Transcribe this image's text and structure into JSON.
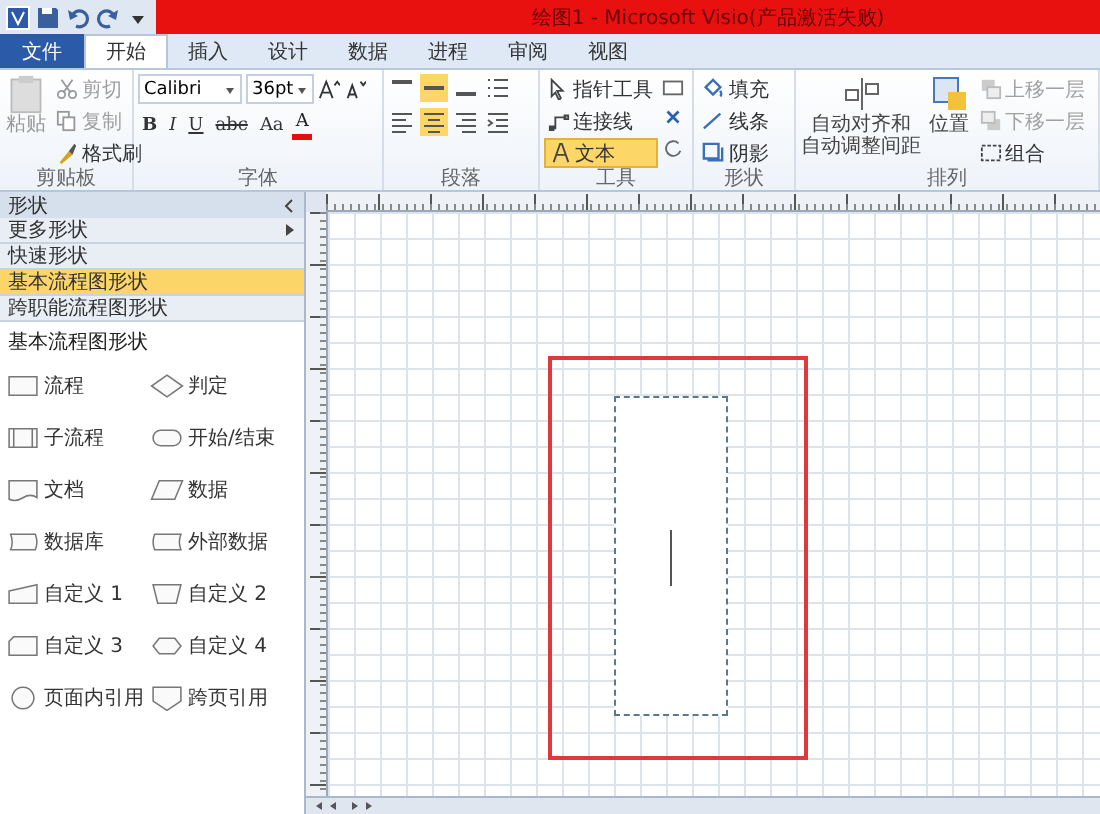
{
  "window": {
    "title": "绘图1 - Microsoft Visio(产品激活失败)"
  },
  "tabs": [
    {
      "label": "文件",
      "kind": "file",
      "selected": false
    },
    {
      "label": "开始",
      "kind": "tab",
      "selected": true
    },
    {
      "label": "插入",
      "kind": "tab",
      "selected": false
    },
    {
      "label": "设计",
      "kind": "tab",
      "selected": false
    },
    {
      "label": "数据",
      "kind": "tab",
      "selected": false
    },
    {
      "label": "进程",
      "kind": "tab",
      "selected": false
    },
    {
      "label": "审阅",
      "kind": "tab",
      "selected": false
    },
    {
      "label": "视图",
      "kind": "tab",
      "selected": false
    }
  ],
  "clipboard": {
    "label": "剪贴板",
    "paste": "粘贴",
    "cut": "剪切",
    "copy": "复制",
    "format_painter": "格式刷"
  },
  "font": {
    "label": "字体",
    "family": "Calibri",
    "size": "36pt",
    "format_buttons": [
      "B",
      "I",
      "U",
      "abc",
      "Aa"
    ],
    "color_button": "A"
  },
  "paragraph": {
    "label": "段落"
  },
  "tools": {
    "label": "工具",
    "items": [
      {
        "label": "指针工具",
        "kind": "pointer",
        "selected": false
      },
      {
        "label": "连接线",
        "kind": "connector",
        "selected": false
      },
      {
        "label": "文本",
        "kind": "text",
        "selected": true
      }
    ]
  },
  "shape": {
    "label": "形状",
    "items": [
      {
        "label": "填充",
        "kind": "fill"
      },
      {
        "label": "线条",
        "kind": "line"
      },
      {
        "label": "阴影",
        "kind": "shadow"
      }
    ]
  },
  "arrange": {
    "label": "排列",
    "auto_align": [
      "自动对齐和",
      "自动调整间距"
    ],
    "position": "位置",
    "bring_forward": "上移一层",
    "send_backward": "下移一层",
    "group": "组合"
  },
  "shapes_panel": {
    "title": "形状",
    "menu": [
      {
        "label": "更多形状",
        "kind": "submenu",
        "selected": false
      },
      {
        "label": "快速形状",
        "kind": "stencil",
        "selected": false
      },
      {
        "label": "基本流程图形状",
        "kind": "stencil",
        "selected": true
      },
      {
        "label": "跨职能流程图形状",
        "kind": "stencil",
        "selected": false
      }
    ],
    "stencil": {
      "title": "基本流程图形状",
      "shapes": [
        {
          "label": "流程",
          "kind": "process"
        },
        {
          "label": "判定",
          "kind": "decision"
        },
        {
          "label": "子流程",
          "kind": "subprocess"
        },
        {
          "label": "开始/结束",
          "kind": "terminator"
        },
        {
          "label": "文档",
          "kind": "document"
        },
        {
          "label": "数据",
          "kind": "data"
        },
        {
          "label": "数据库",
          "kind": "database"
        },
        {
          "label": "外部数据",
          "kind": "external"
        },
        {
          "label": "自定义 1",
          "kind": "custom1"
        },
        {
          "label": "自定义 2",
          "kind": "custom2"
        },
        {
          "label": "自定义 3",
          "kind": "custom3"
        },
        {
          "label": "自定义 4",
          "kind": "custom4"
        },
        {
          "label": "页面内引用",
          "kind": "onpage"
        },
        {
          "label": "跨页引用",
          "kind": "offpage"
        }
      ]
    }
  }
}
